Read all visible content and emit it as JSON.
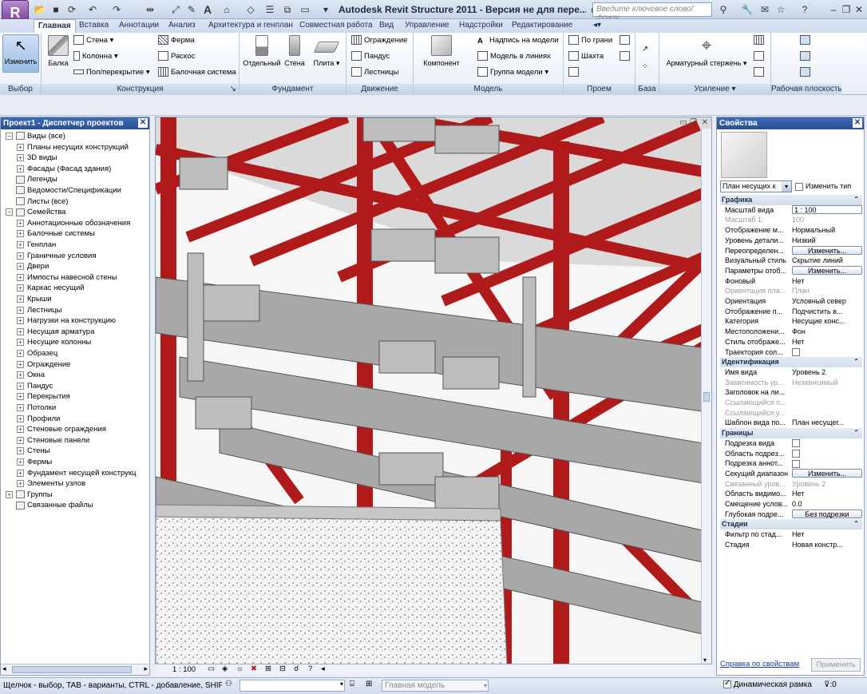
{
  "app": {
    "logo_letter": "R",
    "title": "Autodesk Revit Structure 2011 - Версия не для пере...",
    "search_placeholder": "Введите ключевое слово/фразу"
  },
  "tabs": [
    "Главная",
    "Вставка",
    "Аннотации",
    "Анализ",
    "Архитектура и генплан",
    "Совместная работа",
    "Вид",
    "Управление",
    "Надстройки",
    "Редактирование"
  ],
  "ribbon": {
    "select": {
      "button": "Изменить",
      "label": "Выбор"
    },
    "structure": {
      "beam": "Балка",
      "wall": "Стена",
      "column": "Колонна",
      "floor": "Пол/перекрытие",
      "truss": "Ферма",
      "brace": "Раскос",
      "beam_system": "Балочная система",
      "label": "Конструкция"
    },
    "foundation": {
      "isolated": "Отдельный",
      "wall": "Стена",
      "slab": "Плита",
      "label": "Фундамент"
    },
    "circulation": {
      "railing": "Ограждение",
      "ramp": "Пандус",
      "stair": "Лестницы",
      "label": "Движение"
    },
    "model": {
      "component": "Компонент",
      "text": "Надпись на модели",
      "lines": "Модель в линиях",
      "group": "Группа модели",
      "label": "Модель"
    },
    "opening": {
      "by_face": "По грани",
      "shaft": "Шахта",
      "label": "Проем"
    },
    "datum": {
      "label": "База"
    },
    "reinforcement": {
      "rebar": "Арматурный стержень",
      "label": "Усиление"
    },
    "workplane": {
      "label": "Рабочая плоскость"
    }
  },
  "browser": {
    "title": "Проект1 - Диспетчер проектов",
    "items": [
      {
        "text": "Виды (все)",
        "level": 0,
        "toggle": "−"
      },
      {
        "text": "Планы несущих конструкций",
        "level": 1,
        "toggle": "+"
      },
      {
        "text": "3D виды",
        "level": 1,
        "toggle": "+"
      },
      {
        "text": "Фасады (Фасад здания)",
        "level": 1,
        "toggle": "+"
      },
      {
        "text": "Легенды",
        "level": 0,
        "toggle": ""
      },
      {
        "text": "Ведомости/Спецификации",
        "level": 0,
        "toggle": ""
      },
      {
        "text": "Листы (все)",
        "level": 0,
        "toggle": ""
      },
      {
        "text": "Семейства",
        "level": 0,
        "toggle": "−"
      },
      {
        "text": "Аннотационные обозначения",
        "level": 1,
        "toggle": "+"
      },
      {
        "text": "Балочные системы",
        "level": 1,
        "toggle": "+"
      },
      {
        "text": "Генплан",
        "level": 1,
        "toggle": "+"
      },
      {
        "text": "Граничные условия",
        "level": 1,
        "toggle": "+"
      },
      {
        "text": "Двери",
        "level": 1,
        "toggle": "+"
      },
      {
        "text": "Импосты навесной стены",
        "level": 1,
        "toggle": "+"
      },
      {
        "text": "Каркас несущий",
        "level": 1,
        "toggle": "+"
      },
      {
        "text": "Крыши",
        "level": 1,
        "toggle": "+"
      },
      {
        "text": "Лестницы",
        "level": 1,
        "toggle": "+"
      },
      {
        "text": "Нагрузки на конструкцию",
        "level": 1,
        "toggle": "+"
      },
      {
        "text": "Несущая арматура",
        "level": 1,
        "toggle": "+"
      },
      {
        "text": "Несущие колонны",
        "level": 1,
        "toggle": "+"
      },
      {
        "text": "Образец",
        "level": 1,
        "toggle": "+"
      },
      {
        "text": "Ограждение",
        "level": 1,
        "toggle": "+"
      },
      {
        "text": "Окна",
        "level": 1,
        "toggle": "+"
      },
      {
        "text": "Пандус",
        "level": 1,
        "toggle": "+"
      },
      {
        "text": "Перекрытия",
        "level": 1,
        "toggle": "+"
      },
      {
        "text": "Потолки",
        "level": 1,
        "toggle": "+"
      },
      {
        "text": "Профили",
        "level": 1,
        "toggle": "+"
      },
      {
        "text": "Стеновые ограждения",
        "level": 1,
        "toggle": "+"
      },
      {
        "text": "Стеновые панели",
        "level": 1,
        "toggle": "+"
      },
      {
        "text": "Стены",
        "level": 1,
        "toggle": "+"
      },
      {
        "text": "Фермы",
        "level": 1,
        "toggle": "+"
      },
      {
        "text": "Фундамент несущей конструкц",
        "level": 1,
        "toggle": "+"
      },
      {
        "text": "Элементы узлов",
        "level": 1,
        "toggle": "+"
      },
      {
        "text": "Группы",
        "level": 0,
        "toggle": "+"
      },
      {
        "text": "Связанные файлы",
        "level": 0,
        "toggle": ""
      }
    ]
  },
  "view": {
    "scale": "1 : 100"
  },
  "properties": {
    "title": "Свойства",
    "type_selector": "План несущих к",
    "edit_type": "Изменить тип",
    "rows": [
      {
        "k": "Графика",
        "type": "group"
      },
      {
        "k": "Масштаб вида",
        "v": "1 : 100",
        "type": "input"
      },
      {
        "k": "Масштаб   1:",
        "v": "100",
        "type": "disabled"
      },
      {
        "k": "Отображение м...",
        "v": "Нормальный"
      },
      {
        "k": "Уровень детали...",
        "v": "Низкий"
      },
      {
        "k": "Переопределен...",
        "v": "Изменить...",
        "type": "button"
      },
      {
        "k": "Визуальный стиль",
        "v": "Скрытие линий"
      },
      {
        "k": "Параметры отоб...",
        "v": "Изменить...",
        "type": "button"
      },
      {
        "k": "Фоновый",
        "v": "Нет"
      },
      {
        "k": "Ориентация пла...",
        "v": "План",
        "type": "disabled"
      },
      {
        "k": "Ориентация",
        "v": "Условный север"
      },
      {
        "k": "Отображение п...",
        "v": "Подчистить в..."
      },
      {
        "k": "Категория",
        "v": "Несущие конс..."
      },
      {
        "k": "Местоположени...",
        "v": "Фон"
      },
      {
        "k": "Стиль отображе...",
        "v": "Нет"
      },
      {
        "k": "Траектория сол...",
        "v": "",
        "type": "check"
      },
      {
        "k": "Идентификация",
        "type": "group"
      },
      {
        "k": "Имя вида",
        "v": "Уровень 2"
      },
      {
        "k": "Зависимость ур...",
        "v": "Независимый",
        "type": "disabled"
      },
      {
        "k": "Заголовок на ли...",
        "v": ""
      },
      {
        "k": "Ссылающийся л...",
        "v": "",
        "type": "disabled"
      },
      {
        "k": "Ссылающийся у...",
        "v": "",
        "type": "disabled"
      },
      {
        "k": "Шаблон вида по...",
        "v": "План несущег..."
      },
      {
        "k": "Границы",
        "type": "group"
      },
      {
        "k": "Подрезка вида",
        "v": "",
        "type": "check"
      },
      {
        "k": "Область подрез...",
        "v": "",
        "type": "check"
      },
      {
        "k": "Подрезка аннот...",
        "v": "",
        "type": "check"
      },
      {
        "k": "Секущий диапазон",
        "v": "Изменить...",
        "type": "button"
      },
      {
        "k": "Связанный уров...",
        "v": "Уровень 2",
        "type": "disabled"
      },
      {
        "k": "Область видимо...",
        "v": "Нет"
      },
      {
        "k": "Смещение услов...",
        "v": "0.0"
      },
      {
        "k": "Глубокая подре...",
        "v": "Без подрезки",
        "type": "button"
      },
      {
        "k": "Стадии",
        "type": "group"
      },
      {
        "k": "Фильтр по стад...",
        "v": "Нет"
      },
      {
        "k": "Стадия",
        "v": "Новая констр..."
      }
    ],
    "help_link": "Справка по свойствам",
    "apply": "Применить"
  },
  "status": {
    "hint": "Щелчок - выбор, TAB - варианты, CTRL - добавление, SHIFT - с",
    "model": "Главная модель",
    "dynamic_frame": "Динамическая рамка",
    "filter_count": ":0"
  },
  "colors": {
    "accent": "#2a4f93",
    "steel": "#b01a1a"
  }
}
